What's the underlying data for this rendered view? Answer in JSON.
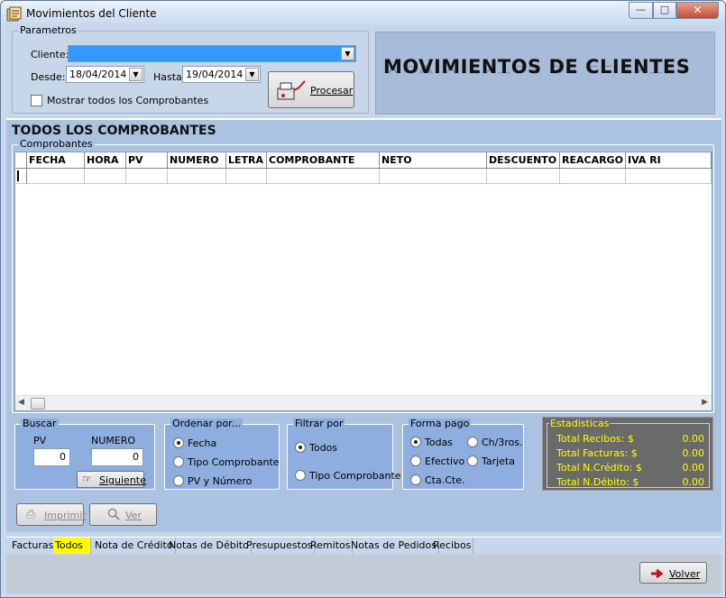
{
  "window": {
    "title": "Movimientos del Cliente"
  },
  "parametros": {
    "legend": "Parametros",
    "cliente_label": "Cliente:",
    "desde_label": "Desde:",
    "desde_value": "18/04/2014",
    "hasta_label": "Hasta:",
    "hasta_value": "19/04/2014",
    "mostrar_label": "Mostrar todos los Comprobantes",
    "procesar_label": "Procesar"
  },
  "banner": {
    "title": "MOVIMIENTOS DE CLIENTES"
  },
  "section": {
    "title": "TODOS LOS COMPROBANTES"
  },
  "comprobantes": {
    "legend": "Comprobantes",
    "columns": [
      "FECHA",
      "HORA",
      "PV",
      "NUMERO",
      "LETRA",
      "COMPROBANTE",
      "NETO",
      "DESCUENTO",
      "REACARGO",
      "IVA RI"
    ]
  },
  "buscar": {
    "legend": "Buscar",
    "pv_label": "PV",
    "pv_value": "0",
    "numero_label": "NUMERO",
    "numero_value": "0",
    "siguiente_label": "Siguiente"
  },
  "ordenar": {
    "legend": "Ordenar por...",
    "options": [
      "Fecha",
      "Tipo Comprobante",
      "PV y Número"
    ]
  },
  "filtrar": {
    "legend": "Filtrar por",
    "options": [
      "Todos",
      "Tipo Comprobante"
    ]
  },
  "forma_pago": {
    "legend": "Forma pago",
    "options": [
      "Todas",
      "Ch/3ros.",
      "Efectivo",
      "Tarjeta",
      "Cta.Cte."
    ]
  },
  "estadisticas": {
    "legend": "Estadisticas",
    "rows": [
      {
        "label": "Total Recibos: $",
        "value": "0.00"
      },
      {
        "label": "Total Facturas: $",
        "value": "0.00"
      },
      {
        "label": "Total N.Crédito: $",
        "value": "0.00"
      },
      {
        "label": "Total N.Débito: $",
        "value": "0.00"
      }
    ]
  },
  "actions": {
    "imprimir_label": "Imprimir",
    "ver_label": "Ver"
  },
  "tabs": [
    "Facturas",
    "Todos",
    "Nota de Crédito",
    "Notas de Débito",
    "Presupuestos",
    "Remitos",
    "Notas de Pedidos",
    "Recibos"
  ],
  "footer": {
    "volver_label": "Volver"
  },
  "colors": {
    "accent_tab": "#ffff00",
    "banner_bg": "#a7bcd8",
    "stats_bg": "#6a6a6a",
    "stats_text": "#ffff00"
  }
}
